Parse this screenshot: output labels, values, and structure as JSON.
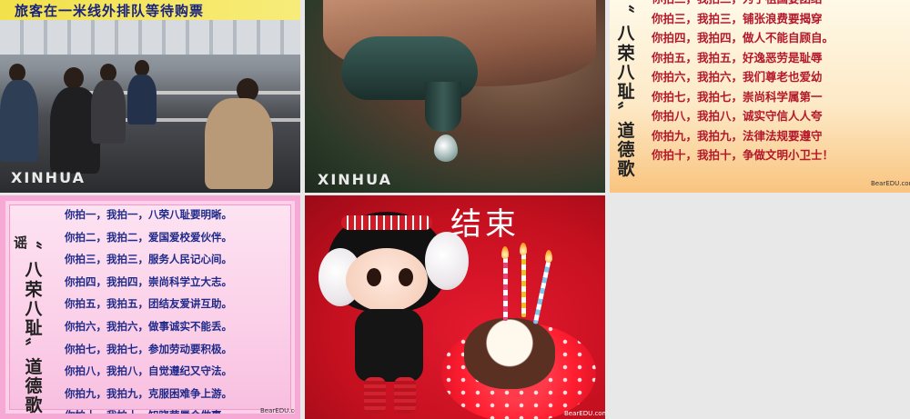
{
  "tiles": {
    "queue": {
      "banner": "旅客在一米线外排队等待购票",
      "watermark": "XINHUA"
    },
    "faucet": {
      "watermark": "XINHUA"
    },
    "song_part": {
      "title_chars": [
        "〝",
        "八",
        "荣",
        "八",
        "耻",
        "〞",
        "道",
        "德",
        "歌"
      ],
      "lines": [
        "你拍二，我拍二，为了祖国要团结",
        "你拍三，我拍三，铺张浪费要揭穿",
        "你拍四，我拍四，做人不能自顾自。",
        "你拍五，我拍五，好逸恶劳是耻辱",
        "你拍六，我拍六，我们尊老也爱幼",
        "你拍七，我拍七，崇尚科学属第一",
        "你拍八，我拍八，诚实守信人人夸",
        "你拍九，我拍九，法律法规要遵守",
        "你拍十，我拍十，争做文明小卫士！"
      ],
      "logo": "BearEDU.com"
    },
    "song_full": {
      "partial_char": "谣",
      "title_chars": [
        "〝",
        "八",
        "荣",
        "八",
        "耻",
        "〞",
        "道",
        "德",
        "歌"
      ],
      "lines": [
        "你拍一，我拍一，八荣八耻要明晰。",
        "你拍二，我拍二，爱国爱校爱伙伴。",
        "你拍三，我拍三，服务人民记心间。",
        "你拍四，我拍四，崇尚科学立大志。",
        "你拍五，我拍五，团结友爱讲互助。",
        "你拍六，我拍六，做事诚实不能丢。",
        "你拍七，我拍七，参加劳动要积极。",
        "你拍八，我拍八，自觉遵纪又守法。",
        "你拍九，我拍九，克服困难争上游。",
        "你拍十，我拍十，知晓荣辱会做事。"
      ],
      "logo": "BearEDU.com"
    },
    "end": {
      "title": "结束",
      "logo": "BearEDU.com"
    }
  },
  "colors": {
    "banner_text": "#1a237e",
    "song_part_text": "#b3182b",
    "song_full_text": "#1e2a8a",
    "end_background": "#d4121f",
    "empty_background": "#e8e8e8"
  }
}
